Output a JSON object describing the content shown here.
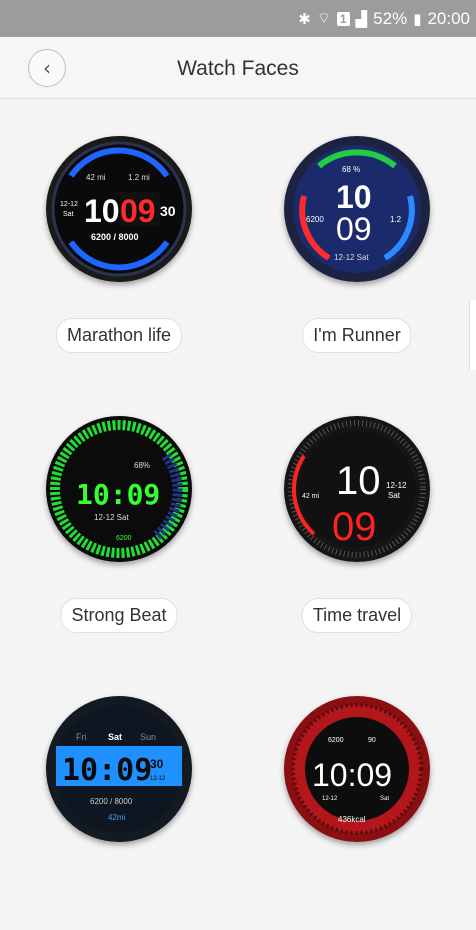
{
  "status_bar": {
    "icons": [
      "bluetooth-icon",
      "wifi-icon",
      "sim-icon",
      "signal-icon"
    ],
    "sim_label": "1",
    "battery": "52%",
    "time": "20:00"
  },
  "header": {
    "title": "Watch Faces"
  },
  "faces": [
    {
      "name": "Marathon life",
      "texts": {
        "dist_left": "42 mi",
        "dist_right": "1.2 mi",
        "date": "12-12",
        "day": "Sat",
        "hour": "10",
        "minute": "09",
        "second": "30",
        "steps": "6200 / 8000"
      }
    },
    {
      "name": "I'm Runner",
      "texts": {
        "battery": "68 %",
        "hour": "10",
        "minute": "09",
        "steps": "6200",
        "dist": "1.2",
        "date": "12-12 Sat"
      }
    },
    {
      "name": "Strong Beat",
      "texts": {
        "battery": "68%",
        "time": "10:09",
        "date": "12-12  Sat",
        "steps": "6200"
      }
    },
    {
      "name": "Time travel",
      "texts": {
        "hour": "10",
        "minute": "09",
        "dist": "42 mi",
        "date": "12-12",
        "day": "Sat"
      }
    },
    {
      "name": "",
      "texts": {
        "day_prev": "Fri",
        "day_cur": "Sat",
        "day_next": "Sun",
        "time": "10:09",
        "second": "30",
        "date": "12-12",
        "steps": "6200 / 8000",
        "dist": "42mi"
      }
    },
    {
      "name": "",
      "texts": {
        "steps": "6200",
        "heart": "90",
        "time": "10:09",
        "date": "12-12",
        "day": "Sat",
        "calories": "436kcal"
      }
    }
  ],
  "colors": {
    "accent_red": "#e8222a",
    "accent_blue": "#1e88ff",
    "accent_green": "#22dd33"
  }
}
